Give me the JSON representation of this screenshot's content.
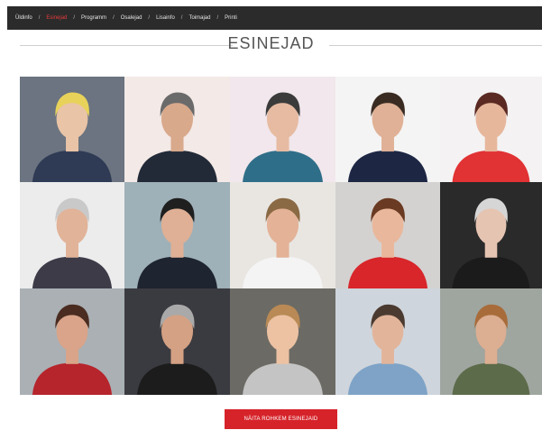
{
  "nav": {
    "items": [
      {
        "label": "Üldinfo",
        "active": false
      },
      {
        "label": "Esinejad",
        "active": true
      },
      {
        "label": "Programm",
        "active": false
      },
      {
        "label": "Osalejad",
        "active": false
      },
      {
        "label": "Lisainfo",
        "active": false
      },
      {
        "label": "Toimajad",
        "active": false
      },
      {
        "label": "Printi",
        "active": false
      }
    ],
    "separator": "/"
  },
  "page": {
    "title": "ESINEJAD"
  },
  "speakers": {
    "count": 15,
    "photos": [
      {
        "bg": "#6b7480",
        "skin": "#e9c4a7",
        "hair": "#e8d25a",
        "cloth": "#2f3a55"
      },
      {
        "bg": "#f3e9e6",
        "skin": "#d9a98c",
        "hair": "#6a6a6a",
        "cloth": "#222a38"
      },
      {
        "bg": "#f1e7ec",
        "skin": "#e6bba2",
        "hair": "#3b3b3b",
        "cloth": "#2f6e88"
      },
      {
        "bg": "#f4f4f4",
        "skin": "#e0b196",
        "hair": "#3a2b22",
        "cloth": "#1d2744"
      },
      {
        "bg": "#f4f2f2",
        "skin": "#e7b79c",
        "hair": "#5a2a22",
        "cloth": "#e13234"
      },
      {
        "bg": "#ececec",
        "skin": "#e1b399",
        "hair": "#c9c9c9",
        "cloth": "#3d3b48"
      },
      {
        "bg": "#9eb0b8",
        "skin": "#dfb095",
        "hair": "#1f1f1f",
        "cloth": "#1e2430"
      },
      {
        "bg": "#e9e6e2",
        "skin": "#e3b297",
        "hair": "#8a6a44",
        "cloth": "#f4f4f4"
      },
      {
        "bg": "#d4d2d0",
        "skin": "#e9b89c",
        "hair": "#6a3a22",
        "cloth": "#d8262b"
      },
      {
        "bg": "#2a2a2a",
        "skin": "#e6c4b2",
        "hair": "#d6d6d6",
        "cloth": "#1b1b1b"
      },
      {
        "bg": "#aab0b4",
        "skin": "#d9a489",
        "hair": "#4a2c20",
        "cloth": "#b6242c"
      },
      {
        "bg": "#3a3b40",
        "skin": "#d4a184",
        "hair": "#a9a9a9",
        "cloth": "#1c1c1c"
      },
      {
        "bg": "#6c6a64",
        "skin": "#ecc2a3",
        "hair": "#b98a55",
        "cloth": "#c4c4c4"
      },
      {
        "bg": "#cfd5dc",
        "skin": "#e2b59b",
        "hair": "#4b3a30",
        "cloth": "#7ea3c7"
      },
      {
        "bg": "#9fa59f",
        "skin": "#dcae92",
        "hair": "#a86c3a",
        "cloth": "#5c6b4a"
      }
    ]
  },
  "cta": {
    "label": "NÄITA ROHKEM ESINEJAID"
  }
}
